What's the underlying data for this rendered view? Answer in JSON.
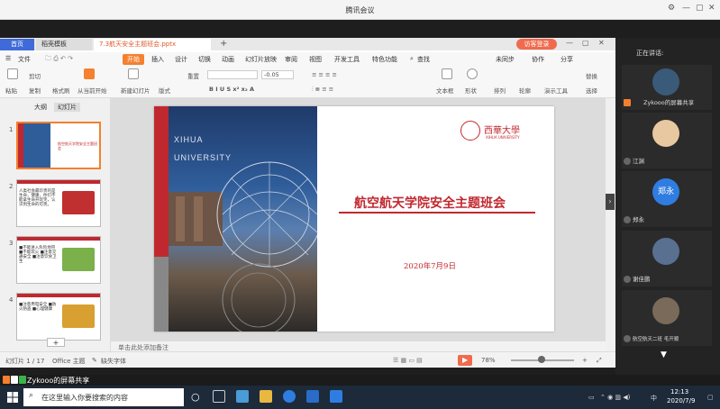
{
  "meeting": {
    "title": "腾讯会议",
    "controls": [
      "⚙",
      "—",
      "▢",
      "✕"
    ]
  },
  "wps": {
    "tabs": {
      "home": "首页",
      "template": "稻壳模板",
      "file": "7.3航天安全主题班会.pptx",
      "add": "+"
    },
    "login": "访客登录",
    "menu": [
      "文件",
      "开始",
      "插入",
      "设计",
      "切换",
      "动画",
      "幻灯片放映",
      "审阅",
      "视图",
      "开发工具",
      "特色功能",
      "查找"
    ],
    "menu_right": [
      "未同步",
      "协作",
      "分享"
    ],
    "ribbon": {
      "paste": "粘贴",
      "cut": "剪切",
      "copy": "复制",
      "format_painter": "格式刷",
      "start_from_current": "从当前开始",
      "new_slide": "新建幻灯片",
      "layout": "版式",
      "reset": "重置",
      "font_size": "-0.05",
      "textbox": "文本框",
      "shapes": "形状",
      "arrange": "排列",
      "outline": "轮廓",
      "slideshow": "演示工具",
      "replace": "替换",
      "select": "选择"
    },
    "pane_tabs": [
      "大纲",
      "幻灯片"
    ],
    "thumbs": [
      {
        "num": "1",
        "text": "航空航天学院安全主题班会"
      },
      {
        "num": "2",
        "text": "人类社会最珍贵的是生命，健康，你们不能拿生命开玩笑，认识到生命的可贵。"
      },
      {
        "num": "3",
        "text": "■不能进入危险地带 ■不能玩火 ■注意交通安全 ■注意饮食卫生"
      },
      {
        "num": "4",
        "text": "■注意用电安全 ■防火防盗 ■心理健康"
      }
    ],
    "add_slide": "+",
    "note_placeholder": "单击此处添加备注",
    "status": {
      "slide_info": "幻灯片 1 / 17",
      "theme": "Office 主题",
      "missing_font": "缺失字体",
      "zoom": "78%"
    }
  },
  "slide": {
    "logo_cn": "西華大學",
    "logo_en": "XIHUA UNIVERSITY",
    "photo_line1": "XIHUA",
    "photo_line2": "UNIVERSITY",
    "title": "航空航天学院安全主题班会",
    "date": "2020年7月9日",
    "accent": "#c0282f"
  },
  "panel": {
    "speaking_label": "正在讲话:",
    "participants": [
      {
        "name": "Zykooo的屏幕共享"
      },
      {
        "name": "江渊"
      },
      {
        "name": "郑永",
        "avatar_text": "郑永"
      },
      {
        "name": "谢佳鹏"
      },
      {
        "name": "航空航天二班 毛开顺"
      }
    ]
  },
  "share": {
    "label": "Zykooo的屏幕共享"
  },
  "taskbar": {
    "search_placeholder": "在这里输入你要搜索的内容",
    "lang": "中",
    "time": "12:13",
    "date": "2020/7/9"
  }
}
